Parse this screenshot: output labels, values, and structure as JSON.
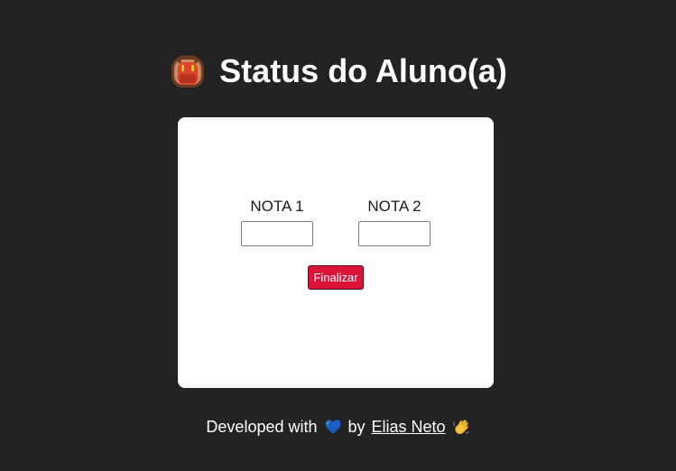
{
  "header": {
    "icon": "backpack-icon",
    "title": "Status do Aluno(a)"
  },
  "form": {
    "nota1_label": "NOTA 1",
    "nota1_value": "",
    "nota2_label": "NOTA 2",
    "nota2_value": "",
    "submit_label": "Finalizar"
  },
  "footer": {
    "prefix": "Developed with",
    "heart_icon": "blue-heart-icon",
    "by": "by",
    "author": "Elias Neto",
    "wave_icon": "waving-hand-icon"
  },
  "colors": {
    "background": "#232323",
    "card": "#ffffff",
    "button": "#dc1439",
    "heart": "#1d5fbf"
  }
}
